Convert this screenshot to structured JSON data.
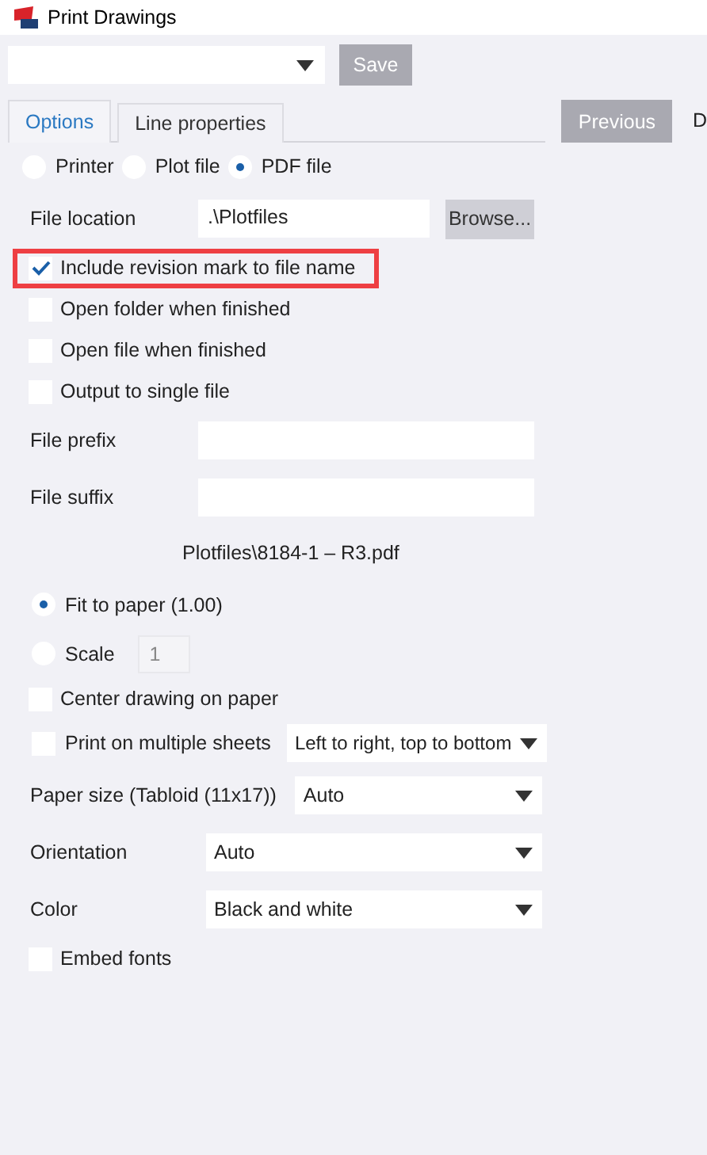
{
  "window": {
    "title": "Print Drawings"
  },
  "save_button": {
    "label": "Save",
    "disabled": true
  },
  "tabs": [
    {
      "label": "Options",
      "selected": true
    },
    {
      "label": "Line properties",
      "selected": false
    }
  ],
  "previous_button": {
    "label": "Previous",
    "disabled": true
  },
  "cut_text": "D",
  "output_types": [
    {
      "label": "Printer",
      "selected": false
    },
    {
      "label": "Plot file",
      "selected": false
    },
    {
      "label": "PDF file",
      "selected": true
    }
  ],
  "file_location": {
    "label": "File location",
    "value": ".\\Plotfiles",
    "button": "Browse..."
  },
  "options": [
    {
      "kind": "checkbox",
      "label": "Include revision mark to file name",
      "checked": true,
      "highlighted": true
    },
    {
      "kind": "checkbox",
      "label": "Open folder when finished",
      "checked": false,
      "highlighted": false
    },
    {
      "kind": "checkbox",
      "label": "Open file when finished",
      "checked": false,
      "highlighted": false
    },
    {
      "kind": "checkbox",
      "label": "Output to single file",
      "checked": false,
      "highlighted": false
    },
    {
      "kind": "field",
      "label": "File prefix"
    },
    {
      "kind": "field",
      "label": "File suffix"
    },
    {
      "kind": "preview",
      "text": "Plotfiles\\8184-1 – R3.pdf"
    },
    {
      "kind": "radio",
      "label": "Fit to paper (1.00)",
      "selected": true
    },
    {
      "kind": "radio",
      "label": "Scale",
      "selected": false,
      "value": "1"
    },
    {
      "kind": "checkbox",
      "label": "Center drawing on paper",
      "checked": false,
      "highlighted": false
    },
    {
      "kind": "checkbox-select",
      "label": "Print on multiple sheets",
      "checked": false,
      "value": "Left to right, top to bottom"
    },
    {
      "kind": "select",
      "label": "Paper size (Tabloid (11x17))",
      "value": "Auto"
    },
    {
      "kind": "select",
      "label": "Orientation",
      "value": "Auto"
    },
    {
      "kind": "select",
      "label": "Color",
      "value": "Black and white"
    },
    {
      "kind": "checkbox",
      "label": "Embed fonts",
      "checked": false,
      "highlighted": false
    }
  ]
}
